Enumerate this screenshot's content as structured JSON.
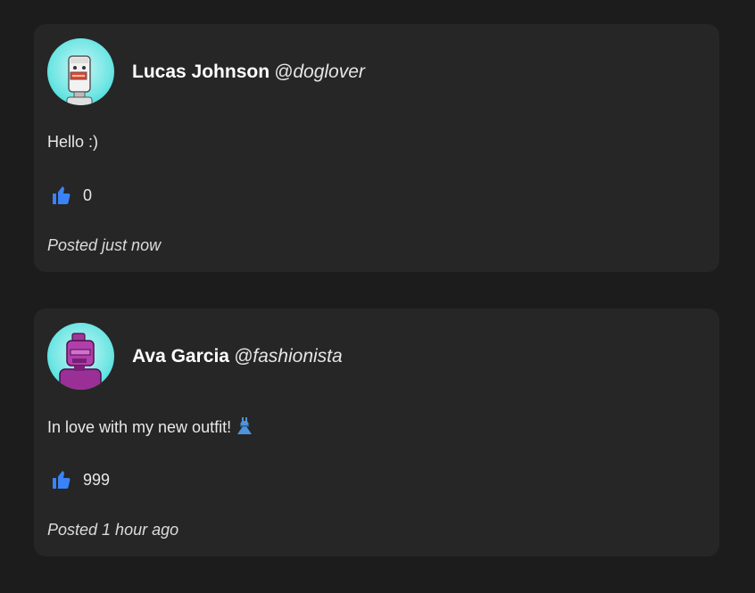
{
  "posts": [
    {
      "display_name": "Lucas Johnson",
      "handle": "@doglover",
      "body": "Hello :)",
      "likes": "0",
      "timestamp": "Posted just now",
      "avatar": "robot-avatar-white",
      "has_dress_emoji": false
    },
    {
      "display_name": "Ava Garcia",
      "handle": "@fashionista",
      "body": "In love with my new outfit!",
      "likes": "999",
      "timestamp": "Posted 1 hour ago",
      "avatar": "robot-avatar-purple",
      "has_dress_emoji": true
    }
  ],
  "colors": {
    "background": "#1c1c1c",
    "card": "#262626",
    "like_icon": "#3b82f6",
    "avatar_bg": "#3fdad8"
  }
}
